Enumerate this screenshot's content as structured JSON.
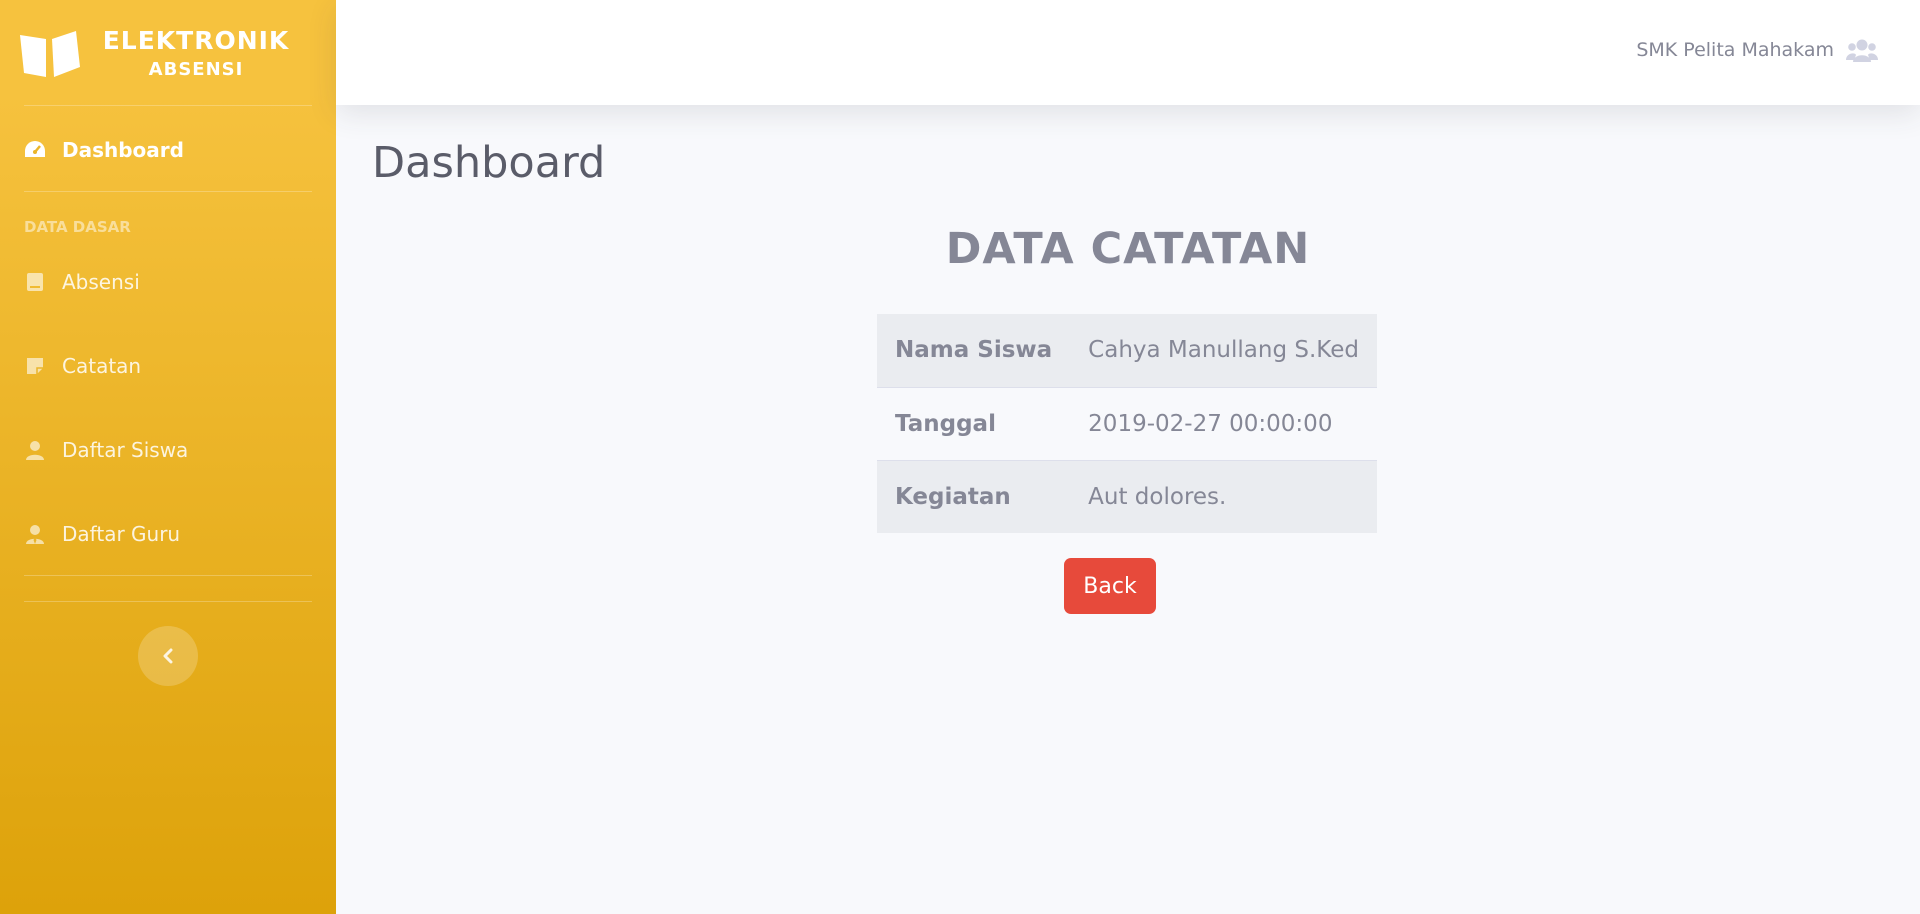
{
  "brand": {
    "line1": "ELEKTRONIK",
    "line2": "ABSENSI",
    "icon": "book-open-icon"
  },
  "sidebar": {
    "dashboard": {
      "label": "Dashboard",
      "icon": "tachometer-icon"
    },
    "heading": "DATA DASAR",
    "items": [
      {
        "label": "Absensi",
        "icon": "book-icon"
      },
      {
        "label": "Catatan",
        "icon": "sticky-note-icon"
      },
      {
        "label": "Daftar Siswa",
        "icon": "user-icon"
      },
      {
        "label": "Daftar Guru",
        "icon": "user-tie-icon"
      }
    ],
    "toggle_icon": "chevron-left-icon"
  },
  "topbar": {
    "user_name": "SMK Pelita Mahakam",
    "user_icon": "users-icon"
  },
  "main": {
    "page_title": "Dashboard",
    "card_title": "DATA CATATAN",
    "rows": [
      {
        "key": "Nama Siswa",
        "value": "Cahya Manullang S.Ked"
      },
      {
        "key": "Tanggal",
        "value": "2019-02-27 00:00:00"
      },
      {
        "key": "Kegiatan",
        "value": "Aut dolores."
      }
    ],
    "back_label": "Back"
  },
  "colors": {
    "sidebar_top": "#f6c23e",
    "sidebar_bottom": "#dda20a",
    "danger": "#e74a3b",
    "background": "#f8f9fc"
  }
}
